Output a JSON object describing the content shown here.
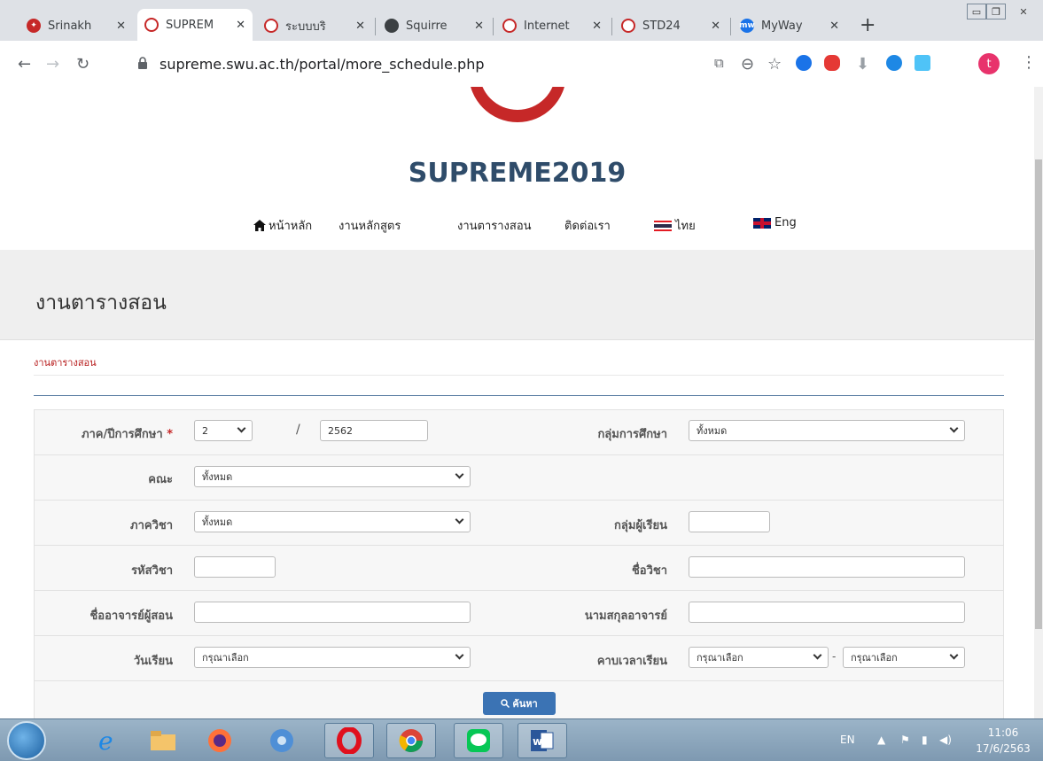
{
  "browser": {
    "tabs": [
      {
        "label": "Srinakh",
        "color": "#c62828"
      },
      {
        "label": "SUPREM",
        "color": "#c62828"
      },
      {
        "label": "ระบบบริ",
        "color": "#c62828"
      },
      {
        "label": "Squirre",
        "color": "#3c4043"
      },
      {
        "label": "Internet",
        "color": "#c62828"
      },
      {
        "label": "STD24",
        "color": "#c62828"
      },
      {
        "label": "MyWay",
        "color": "#1a73e8"
      }
    ],
    "tab_close": "✕",
    "new_tab": "+",
    "url": "supreme.swu.ac.th/portal/more_schedule.php",
    "profile_initial": "t"
  },
  "site": {
    "title": "SUPREME2019",
    "nav": {
      "home": "หน้าหลัก",
      "curriculum": "งานหลักสูตร",
      "schedule": "งานตารางสอน",
      "contact": "ติดต่อเรา",
      "thai": "ไทย",
      "eng": "Eng"
    },
    "page_title": "งานตารางสอน",
    "breadcrumb": "งานตารางสอน"
  },
  "form": {
    "semester_label": "ภาค/ปีการศึกษา",
    "required_mark": "*",
    "semester_value": "2",
    "year_value": "2562",
    "slash": "/",
    "study_group_label": "กลุ่มการศึกษา",
    "study_group_value": "ทั้งหมด",
    "faculty_label": "คณะ",
    "faculty_value": "ทั้งหมด",
    "department_label": "ภาควิชา",
    "department_value": "ทั้งหมด",
    "student_group_label": "กลุ่มผู้เรียน",
    "student_group_value": "",
    "course_code_label": "รหัสวิชา",
    "course_code_value": "",
    "course_name_label": "ชื่อวิชา",
    "course_name_value": "",
    "instructor_first_label": "ชื่ออาจารย์ผู้สอน",
    "instructor_first_value": "",
    "instructor_last_label": "นามสกุลอาจารย์",
    "instructor_last_value": "",
    "day_label": "วันเรียน",
    "day_value": "กรุณาเลือก",
    "period_label": "คาบเวลาเรียน",
    "period_from_value": "กรุณาเลือก",
    "period_dash": "-",
    "period_to_value": "กรุณาเลือก",
    "search_button": "ค้นหา"
  },
  "taskbar": {
    "lang": "EN",
    "time": "11:06",
    "date": "17/6/2563"
  }
}
